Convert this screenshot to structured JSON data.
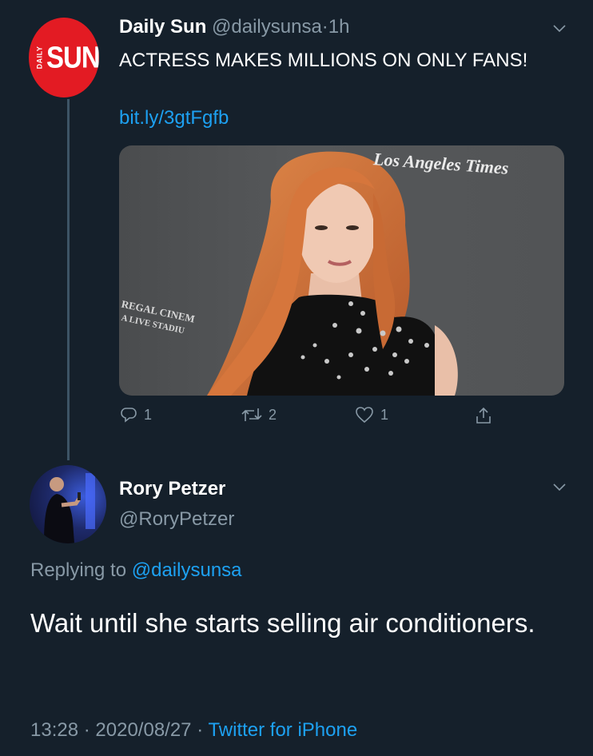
{
  "tweet": {
    "author_name": "Daily Sun",
    "author_handle": "@dailysunsa",
    "separator": "·",
    "age": "1h",
    "avatar_brand_small": "DAILY",
    "avatar_brand_large": "SUN",
    "text": "ACTRESS MAKES MILLIONS ON ONLY FANS!",
    "url": "bit.ly/3gtFgfb",
    "image": {
      "watermark": "Los Angeles Times",
      "backdrop_text_1": "REGAL CINEM",
      "backdrop_text_2": "A LIVE STADIU"
    },
    "actions": {
      "reply_count": "1",
      "retweet_count": "2",
      "like_count": "1"
    }
  },
  "reply": {
    "author_name": "Rory Petzer",
    "author_handle": "@RoryPetzer",
    "replying_prefix": "Replying to",
    "replying_to": "@dailysunsa",
    "text": "Wait until she starts selling air conditioners.",
    "time": "13:28",
    "date": "2020/08/27",
    "separator": "·",
    "source": "Twitter for iPhone"
  },
  "colors": {
    "background": "#15202b",
    "text": "#ffffff",
    "muted": "#8899a6",
    "link": "#1da1f2",
    "sun_red": "#e31b23"
  },
  "icons": [
    "chevron-down-icon",
    "reply-icon",
    "retweet-icon",
    "like-icon",
    "share-icon"
  ]
}
